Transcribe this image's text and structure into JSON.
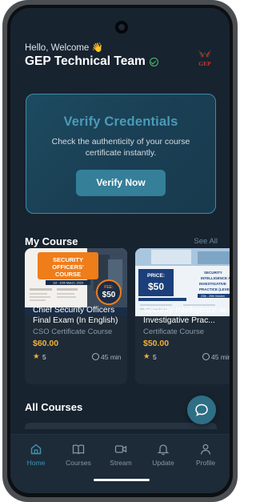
{
  "header": {
    "greeting": "Hello, Welcome 👋",
    "team_name": "GEP Technical Team",
    "logo_text": "GEP"
  },
  "verify": {
    "title": "Verify Credentials",
    "description": "Check the authenticity of your course certificate instantly.",
    "button": "Verify Now"
  },
  "my_course": {
    "title": "My Course",
    "see_all": "See All",
    "courses": [
      {
        "image_title": "SECURITY OFFICERS' COURSE",
        "image_dates": "1st - 10th March, 2023",
        "image_fee_label": "FEE:",
        "image_fee": "$50",
        "title": "Chief Security Officers Final Exam (In English)",
        "category": "CSO Certificate Course",
        "price": "$60.00",
        "rating": "5",
        "duration": "45 min"
      },
      {
        "image_price_label": "PRICE:",
        "image_price": "$50",
        "image_title": "SECURITY INTELLIGENCE AND INVESTIGATIVE PRACTICE (LEVEL",
        "image_dates": "23th - 25th October",
        "title": "Security Intelligence and Investigative Prac...",
        "category": "Certificate Course",
        "price": "$50.00",
        "rating": "5",
        "duration": "45 min"
      }
    ]
  },
  "all_courses": {
    "title": "All Courses"
  },
  "nav": [
    {
      "label": "Home",
      "icon": "home-icon",
      "active": true
    },
    {
      "label": "Courses",
      "icon": "book-icon",
      "active": false
    },
    {
      "label": "Stream",
      "icon": "video-icon",
      "active": false
    },
    {
      "label": "Update",
      "icon": "bell-icon",
      "active": false
    },
    {
      "label": "Profile",
      "icon": "person-icon",
      "active": false
    }
  ],
  "colors": {
    "background": "#17232f",
    "accent": "#357f99",
    "price": "#f0b23a",
    "active_nav": "#3f95b4"
  }
}
